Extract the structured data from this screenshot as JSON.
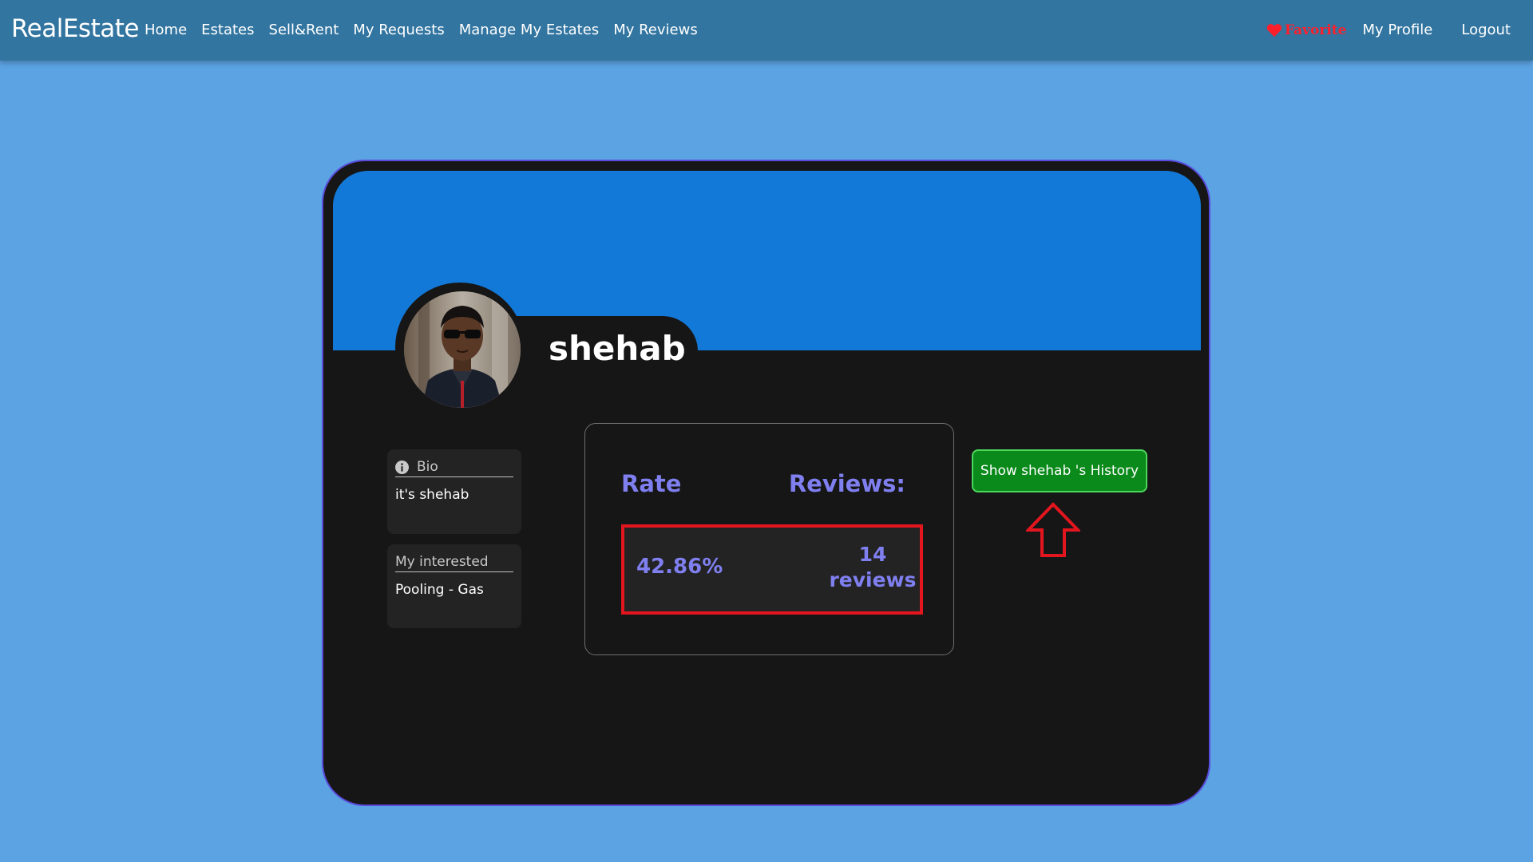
{
  "navbar": {
    "brand": "RealEstate",
    "links": [
      "Home",
      "Estates",
      "Sell&Rent",
      "My Requests",
      "Manage My Estates",
      "My Reviews"
    ],
    "favorite": "Favorite",
    "my_profile": "My Profile",
    "logout": "Logout"
  },
  "profile": {
    "username": "shehab",
    "bio": {
      "label": "Bio",
      "value": "it's shehab"
    },
    "interest": {
      "label": "My interested",
      "value": "Pooling - Gas"
    }
  },
  "stats": {
    "rate_label": "Rate",
    "reviews_label": "Reviews:",
    "rate_value": "42.86%",
    "reviews_count": "14",
    "reviews_unit": "reviews"
  },
  "history_button": "Show shehab 's History",
  "icons": {
    "favorite": "heart-icon",
    "bio": "info-icon",
    "annotation": "arrow-up-outline-icon"
  },
  "colors": {
    "page_bg": "#5ca3e3",
    "navbar_bg": "#3275a0",
    "card_bg": "#161616",
    "cover_bg": "#1379d8",
    "accent_text": "#7f7ff0",
    "highlight_red": "#e3151e",
    "button_green": "#0a8a1a"
  }
}
